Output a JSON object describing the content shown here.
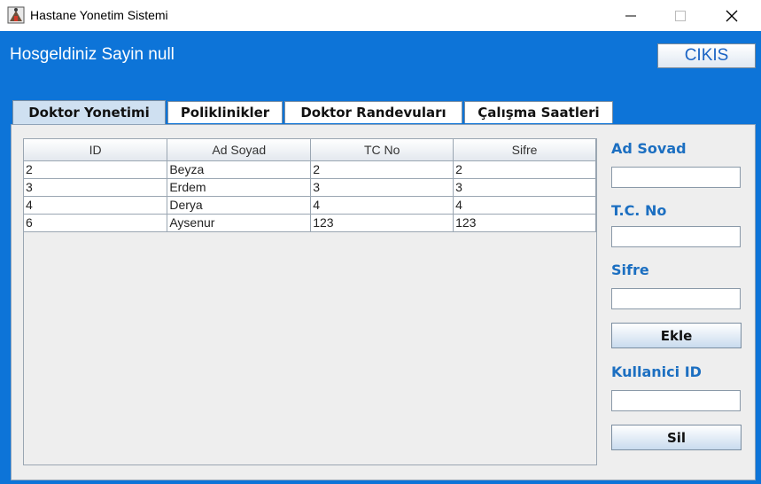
{
  "window": {
    "title": "Hastane Yonetim Sistemi",
    "icons": [
      "app-icon",
      "minimize-icon",
      "maximize-icon",
      "close-icon"
    ]
  },
  "header": {
    "welcome": "Hosgeldiniz Sayin null",
    "exit_label": "CIKIS"
  },
  "tabs": [
    {
      "label": "Doktor Yonetimi",
      "active": true
    },
    {
      "label": "Poliklinikler",
      "active": false
    },
    {
      "label": "Doktor Randevuları",
      "active": false
    },
    {
      "label": "Çalışma Saatleri",
      "active": false
    }
  ],
  "table": {
    "columns": [
      "ID",
      "Ad Soyad",
      "TC No",
      "Sifre"
    ],
    "rows": [
      [
        "2",
        "Beyza",
        "2",
        "2"
      ],
      [
        "3",
        "Erdem",
        "3",
        "3"
      ],
      [
        "4",
        "Derya",
        "4",
        "4"
      ],
      [
        "6",
        "Aysenur",
        "123",
        "123"
      ]
    ]
  },
  "form": {
    "name_label": "Ad Sovad",
    "name_value": "",
    "tc_label": "T.C. No",
    "tc_value": "",
    "password_label": "Sifre",
    "password_value": "",
    "add_button": "Ekle",
    "user_id_label": "Kullanici ID",
    "user_id_value": "",
    "delete_button": "Sil"
  },
  "colors": {
    "frame_blue": "#0d74d8",
    "label_blue": "#1c6fc1",
    "panel_bg": "#eeeeee"
  }
}
